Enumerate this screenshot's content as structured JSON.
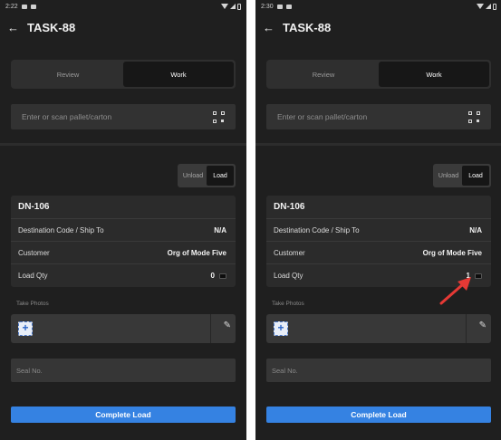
{
  "screens": [
    {
      "status": {
        "time": "2:22"
      },
      "title": "TASK-88",
      "segments": [
        "Review",
        "Work"
      ],
      "scan_placeholder": "Enter or scan pallet/carton",
      "toggle": [
        "Unload",
        "Load"
      ],
      "card": {
        "dn": "DN-106",
        "rows": [
          {
            "label": "Destination Code / Ship To",
            "value": "N/A"
          },
          {
            "label": "Customer",
            "value": "Org of Mode Five"
          },
          {
            "label": "Load Qty",
            "value": "0"
          }
        ]
      },
      "photos_label": "Take Photos",
      "add_symbol": "+",
      "seal_placeholder": "Seal No.",
      "complete_label": "Complete Load"
    },
    {
      "status": {
        "time": "2:30"
      },
      "title": "TASK-88",
      "segments": [
        "Review",
        "Work"
      ],
      "scan_placeholder": "Enter or scan pallet/carton",
      "toggle": [
        "Unload",
        "Load"
      ],
      "card": {
        "dn": "DN-106",
        "rows": [
          {
            "label": "Destination Code / Ship To",
            "value": "N/A"
          },
          {
            "label": "Customer",
            "value": "Org of Mode Five"
          },
          {
            "label": "Load Qty",
            "value": "1"
          }
        ]
      },
      "photos_label": "Take Photos",
      "add_symbol": "+",
      "seal_placeholder": "Seal No.",
      "complete_label": "Complete Load"
    }
  ],
  "colors": {
    "background": "#1f1f1f",
    "accent": "#3582e2",
    "annotation_arrow": "#e53935"
  },
  "icons": {
    "back": "arrow-left-icon",
    "scan": "qr-code-icon",
    "add_photo": "plus-icon",
    "edit": "pencil-icon",
    "qty_action": "keyboard-icon"
  }
}
